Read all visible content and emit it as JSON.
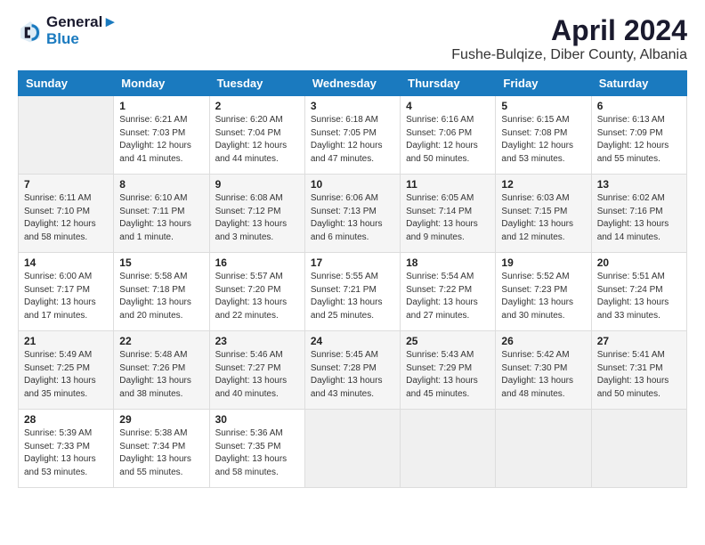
{
  "header": {
    "logo_line1": "General",
    "logo_line2": "Blue",
    "month": "April 2024",
    "location": "Fushe-Bulqize, Diber County, Albania"
  },
  "weekdays": [
    "Sunday",
    "Monday",
    "Tuesday",
    "Wednesday",
    "Thursday",
    "Friday",
    "Saturday"
  ],
  "weeks": [
    [
      {
        "day": "",
        "info": ""
      },
      {
        "day": "1",
        "info": "Sunrise: 6:21 AM\nSunset: 7:03 PM\nDaylight: 12 hours\nand 41 minutes."
      },
      {
        "day": "2",
        "info": "Sunrise: 6:20 AM\nSunset: 7:04 PM\nDaylight: 12 hours\nand 44 minutes."
      },
      {
        "day": "3",
        "info": "Sunrise: 6:18 AM\nSunset: 7:05 PM\nDaylight: 12 hours\nand 47 minutes."
      },
      {
        "day": "4",
        "info": "Sunrise: 6:16 AM\nSunset: 7:06 PM\nDaylight: 12 hours\nand 50 minutes."
      },
      {
        "day": "5",
        "info": "Sunrise: 6:15 AM\nSunset: 7:08 PM\nDaylight: 12 hours\nand 53 minutes."
      },
      {
        "day": "6",
        "info": "Sunrise: 6:13 AM\nSunset: 7:09 PM\nDaylight: 12 hours\nand 55 minutes."
      }
    ],
    [
      {
        "day": "7",
        "info": "Sunrise: 6:11 AM\nSunset: 7:10 PM\nDaylight: 12 hours\nand 58 minutes."
      },
      {
        "day": "8",
        "info": "Sunrise: 6:10 AM\nSunset: 7:11 PM\nDaylight: 13 hours\nand 1 minute."
      },
      {
        "day": "9",
        "info": "Sunrise: 6:08 AM\nSunset: 7:12 PM\nDaylight: 13 hours\nand 3 minutes."
      },
      {
        "day": "10",
        "info": "Sunrise: 6:06 AM\nSunset: 7:13 PM\nDaylight: 13 hours\nand 6 minutes."
      },
      {
        "day": "11",
        "info": "Sunrise: 6:05 AM\nSunset: 7:14 PM\nDaylight: 13 hours\nand 9 minutes."
      },
      {
        "day": "12",
        "info": "Sunrise: 6:03 AM\nSunset: 7:15 PM\nDaylight: 13 hours\nand 12 minutes."
      },
      {
        "day": "13",
        "info": "Sunrise: 6:02 AM\nSunset: 7:16 PM\nDaylight: 13 hours\nand 14 minutes."
      }
    ],
    [
      {
        "day": "14",
        "info": "Sunrise: 6:00 AM\nSunset: 7:17 PM\nDaylight: 13 hours\nand 17 minutes."
      },
      {
        "day": "15",
        "info": "Sunrise: 5:58 AM\nSunset: 7:18 PM\nDaylight: 13 hours\nand 20 minutes."
      },
      {
        "day": "16",
        "info": "Sunrise: 5:57 AM\nSunset: 7:20 PM\nDaylight: 13 hours\nand 22 minutes."
      },
      {
        "day": "17",
        "info": "Sunrise: 5:55 AM\nSunset: 7:21 PM\nDaylight: 13 hours\nand 25 minutes."
      },
      {
        "day": "18",
        "info": "Sunrise: 5:54 AM\nSunset: 7:22 PM\nDaylight: 13 hours\nand 27 minutes."
      },
      {
        "day": "19",
        "info": "Sunrise: 5:52 AM\nSunset: 7:23 PM\nDaylight: 13 hours\nand 30 minutes."
      },
      {
        "day": "20",
        "info": "Sunrise: 5:51 AM\nSunset: 7:24 PM\nDaylight: 13 hours\nand 33 minutes."
      }
    ],
    [
      {
        "day": "21",
        "info": "Sunrise: 5:49 AM\nSunset: 7:25 PM\nDaylight: 13 hours\nand 35 minutes."
      },
      {
        "day": "22",
        "info": "Sunrise: 5:48 AM\nSunset: 7:26 PM\nDaylight: 13 hours\nand 38 minutes."
      },
      {
        "day": "23",
        "info": "Sunrise: 5:46 AM\nSunset: 7:27 PM\nDaylight: 13 hours\nand 40 minutes."
      },
      {
        "day": "24",
        "info": "Sunrise: 5:45 AM\nSunset: 7:28 PM\nDaylight: 13 hours\nand 43 minutes."
      },
      {
        "day": "25",
        "info": "Sunrise: 5:43 AM\nSunset: 7:29 PM\nDaylight: 13 hours\nand 45 minutes."
      },
      {
        "day": "26",
        "info": "Sunrise: 5:42 AM\nSunset: 7:30 PM\nDaylight: 13 hours\nand 48 minutes."
      },
      {
        "day": "27",
        "info": "Sunrise: 5:41 AM\nSunset: 7:31 PM\nDaylight: 13 hours\nand 50 minutes."
      }
    ],
    [
      {
        "day": "28",
        "info": "Sunrise: 5:39 AM\nSunset: 7:33 PM\nDaylight: 13 hours\nand 53 minutes."
      },
      {
        "day": "29",
        "info": "Sunrise: 5:38 AM\nSunset: 7:34 PM\nDaylight: 13 hours\nand 55 minutes."
      },
      {
        "day": "30",
        "info": "Sunrise: 5:36 AM\nSunset: 7:35 PM\nDaylight: 13 hours\nand 58 minutes."
      },
      {
        "day": "",
        "info": ""
      },
      {
        "day": "",
        "info": ""
      },
      {
        "day": "",
        "info": ""
      },
      {
        "day": "",
        "info": ""
      }
    ]
  ]
}
